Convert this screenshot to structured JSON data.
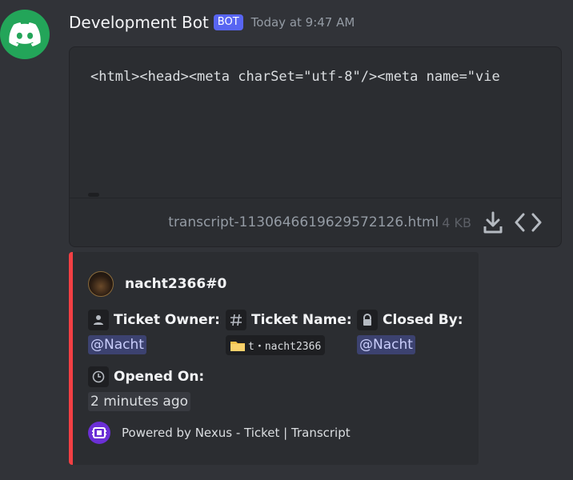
{
  "message": {
    "author": "Development Bot",
    "bot_tag": "BOT",
    "timestamp": "Today at 9:47 AM",
    "avatar_icon": "discord-logo-icon"
  },
  "attachment": {
    "preview": "<html><head><meta charSet=\"utf-8\"/><meta name=\"vie",
    "filename": "transcript-1130646619629572126.html",
    "size": "4 KB",
    "icons": [
      "download-icon",
      "code-icon"
    ]
  },
  "embed": {
    "color": "#f23f43",
    "author": "nacht2366#0",
    "fields": {
      "owner": {
        "icon": "person-icon",
        "name": "Ticket Owner:",
        "value": "@Nacht"
      },
      "ticket": {
        "icon": "hash-icon",
        "name": "Ticket Name:",
        "value": "t・nacht2366",
        "value_icon": "folder-icon"
      },
      "closed": {
        "icon": "lock-icon",
        "name": "Closed By:",
        "value": "@Nacht"
      },
      "opened": {
        "icon": "clock-icon",
        "name": "Opened On:",
        "value": "2 minutes ago"
      }
    },
    "footer": {
      "icon": "nexus-logo-icon",
      "text": "Powered by Nexus - Ticket | Transcript"
    }
  },
  "colors": {
    "background": "#313338",
    "attachment_bg": "#2b2d31",
    "bot_tag": "#5865f2",
    "mention_bg": "#3c4270",
    "avatar_bg": "#23a559"
  }
}
